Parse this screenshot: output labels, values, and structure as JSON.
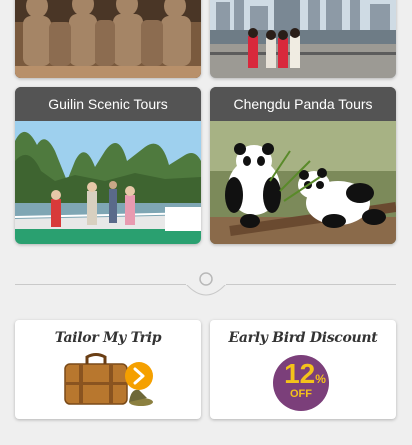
{
  "tours": [
    {
      "title": ""
    },
    {
      "title": ""
    },
    {
      "title": "Guilin Scenic Tours"
    },
    {
      "title": "Chengdu Panda Tours"
    }
  ],
  "promos": {
    "tailor": {
      "title": "Tailor My Trip"
    },
    "early_bird": {
      "title": "Early Bird Discount",
      "discount_number": "12",
      "discount_unit": "%",
      "discount_label": "OFF"
    }
  },
  "colors": {
    "background": "#efefef",
    "card_bar": "#545454",
    "accent_orange": "#f5a000",
    "badge_purple": "#7b3f7a",
    "badge_yellow": "#f4c21a"
  },
  "icons": [
    "chevron-right-icon",
    "suitcase-icon",
    "discount-badge-icon"
  ]
}
